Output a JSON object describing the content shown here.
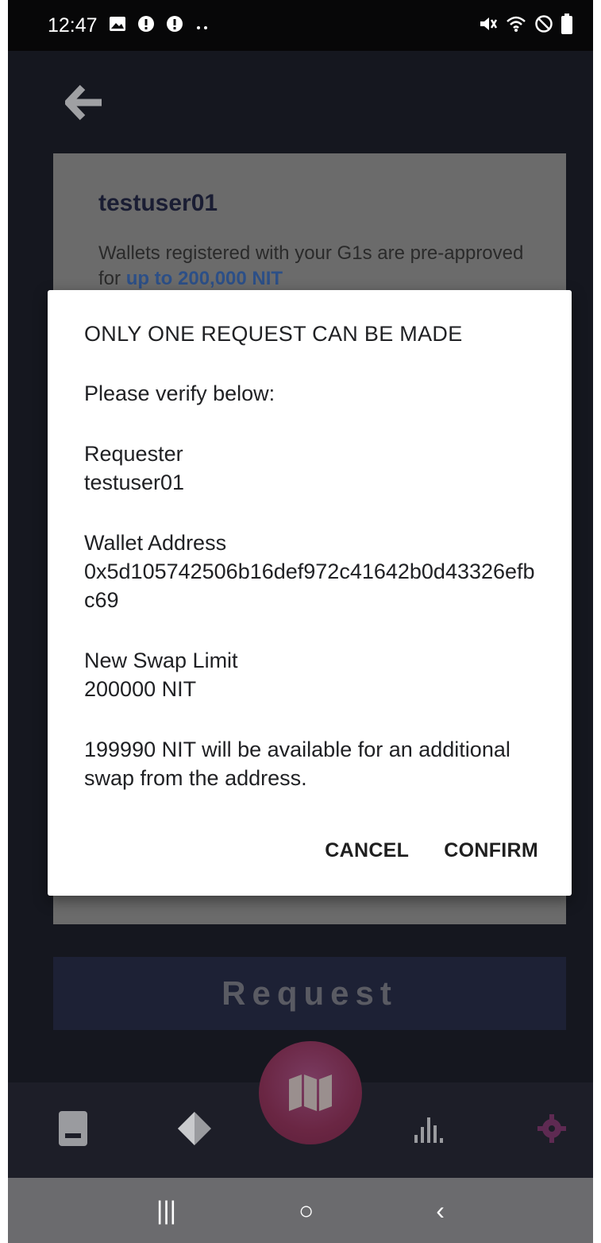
{
  "status_bar": {
    "time": "12:47",
    "left_icons": [
      "image-icon",
      "alert-icon",
      "alert-icon",
      "more-dots-icon"
    ],
    "right_icons": [
      "mute-icon",
      "wifi-icon",
      "block-icon",
      "battery-icon"
    ]
  },
  "background": {
    "username": "testuser01",
    "note_prefix": "Wallets registered with your G1s are pre-approved for ",
    "note_highlight": "up to 200,000 NIT",
    "request_label": "Request"
  },
  "dialog": {
    "title": "ONLY ONE REQUEST CAN BE MADE",
    "intro": "Please verify below:",
    "requester_label": "Requester",
    "requester_value": "testuser01",
    "wallet_label": "Wallet Address",
    "wallet_value": "0x5d105742506b16def972c41642b0d43326efbc69",
    "limit_label": "New Swap Limit",
    "limit_value": "200000 NIT",
    "availability_note": "199990 NIT will be available for an additional swap from the address.",
    "cancel_label": "CANCEL",
    "confirm_label": "CONFIRM"
  },
  "bottom_nav": {
    "items": [
      "wallet-icon",
      "tag-icon",
      "map-icon",
      "chart-icon",
      "settings-icon"
    ]
  },
  "system_nav": {
    "recents": "|||",
    "home": "○",
    "back": "‹"
  },
  "colors": {
    "highlight": "#2c4f87",
    "center_button": "#6a2643",
    "request_button": "#1d2135"
  }
}
